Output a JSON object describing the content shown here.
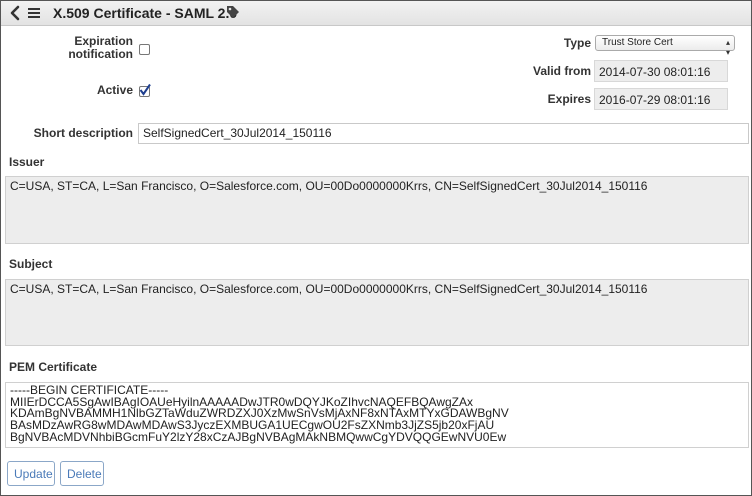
{
  "header": {
    "title": "X.509 Certificate - SAML 2.0"
  },
  "form": {
    "expiration_label_line1": "Expiration",
    "expiration_label_line2": "notification",
    "expiration_checked": false,
    "active_label": "Active",
    "active_checked": true,
    "type_label": "Type",
    "type_value": "Trust Store Cert",
    "valid_from_label": "Valid from",
    "valid_from_value": "2014-07-30 08:01:16",
    "expires_label": "Expires",
    "expires_value": "2016-07-29 08:01:16",
    "short_description_label": "Short description",
    "short_description_value": "SelfSignedCert_30Jul2014_150116"
  },
  "issuer": {
    "label": "Issuer",
    "value": "C=USA, ST=CA, L=San Francisco, O=Salesforce.com, OU=00Do0000000Krrs, CN=SelfSignedCert_30Jul2014_150116"
  },
  "subject": {
    "label": "Subject",
    "value": "C=USA, ST=CA, L=San Francisco, O=Salesforce.com, OU=00Do0000000Krrs, CN=SelfSignedCert_30Jul2014_150116"
  },
  "pem": {
    "label": "PEM Certificate",
    "lines": [
      "-----BEGIN CERTIFICATE-----",
      "MIIErDCCA5SgAwIBAgIOAUeHyilnAAAAADwJTR0wDQYJKoZIhvcNAQEFBQAwgZAx",
      "KDAmBgNVBAMMH1NlbGZTaWduZWRDZXJ0XzMwSnVsMjAxNF8xNTAxMTYxGDAWBgNV",
      "BAsMDzAwRG8wMDAwMDAwS3JyczEXMBUGA1UECgwOU2FsZXNmb3JjZS5jb20xFjAU",
      "BgNVBAcMDVNhbiBGcmFuY2lzY28xCzAJBgNVBAgMAkNBMQwwCgYDVQQGEwNVU0Ew"
    ]
  },
  "actions": {
    "update_label": "Update",
    "delete_label": "Delete"
  },
  "colors": {
    "accent": "#4a7ab8",
    "readonly_bg": "#ededed"
  },
  "icons": {
    "back": "back-icon",
    "menu": "menu-icon",
    "tag": "tag-icon",
    "checkmark": "checkmark-icon"
  }
}
